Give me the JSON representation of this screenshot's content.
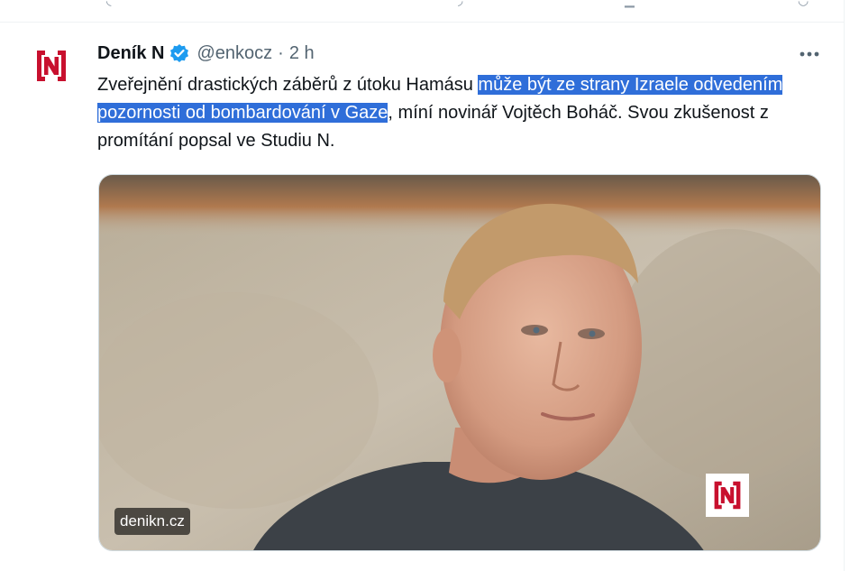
{
  "tweet": {
    "display_name": "Deník N",
    "handle": "@enkocz",
    "separator": "·",
    "time": "2 h",
    "text_before": "Zveřejnění drastických záběrů z útoku Hamásu ",
    "text_highlighted": "může být ze strany Izraele odvedením pozornosti od bombardování v Gaze",
    "text_after": ", míní novinář Vojtěch Boháč. Svou zkušenost z promítání popsal ve Studiu N.",
    "media": {
      "domain": "denikn.cz"
    }
  },
  "colors": {
    "brand_red": "#c8102e",
    "verified_blue": "#1d9bf0",
    "highlight": "#2f6ed9"
  },
  "icons": {
    "avatar": "denik-n-logo-icon",
    "verified": "verified-badge-icon",
    "more": "more-options-icon"
  }
}
